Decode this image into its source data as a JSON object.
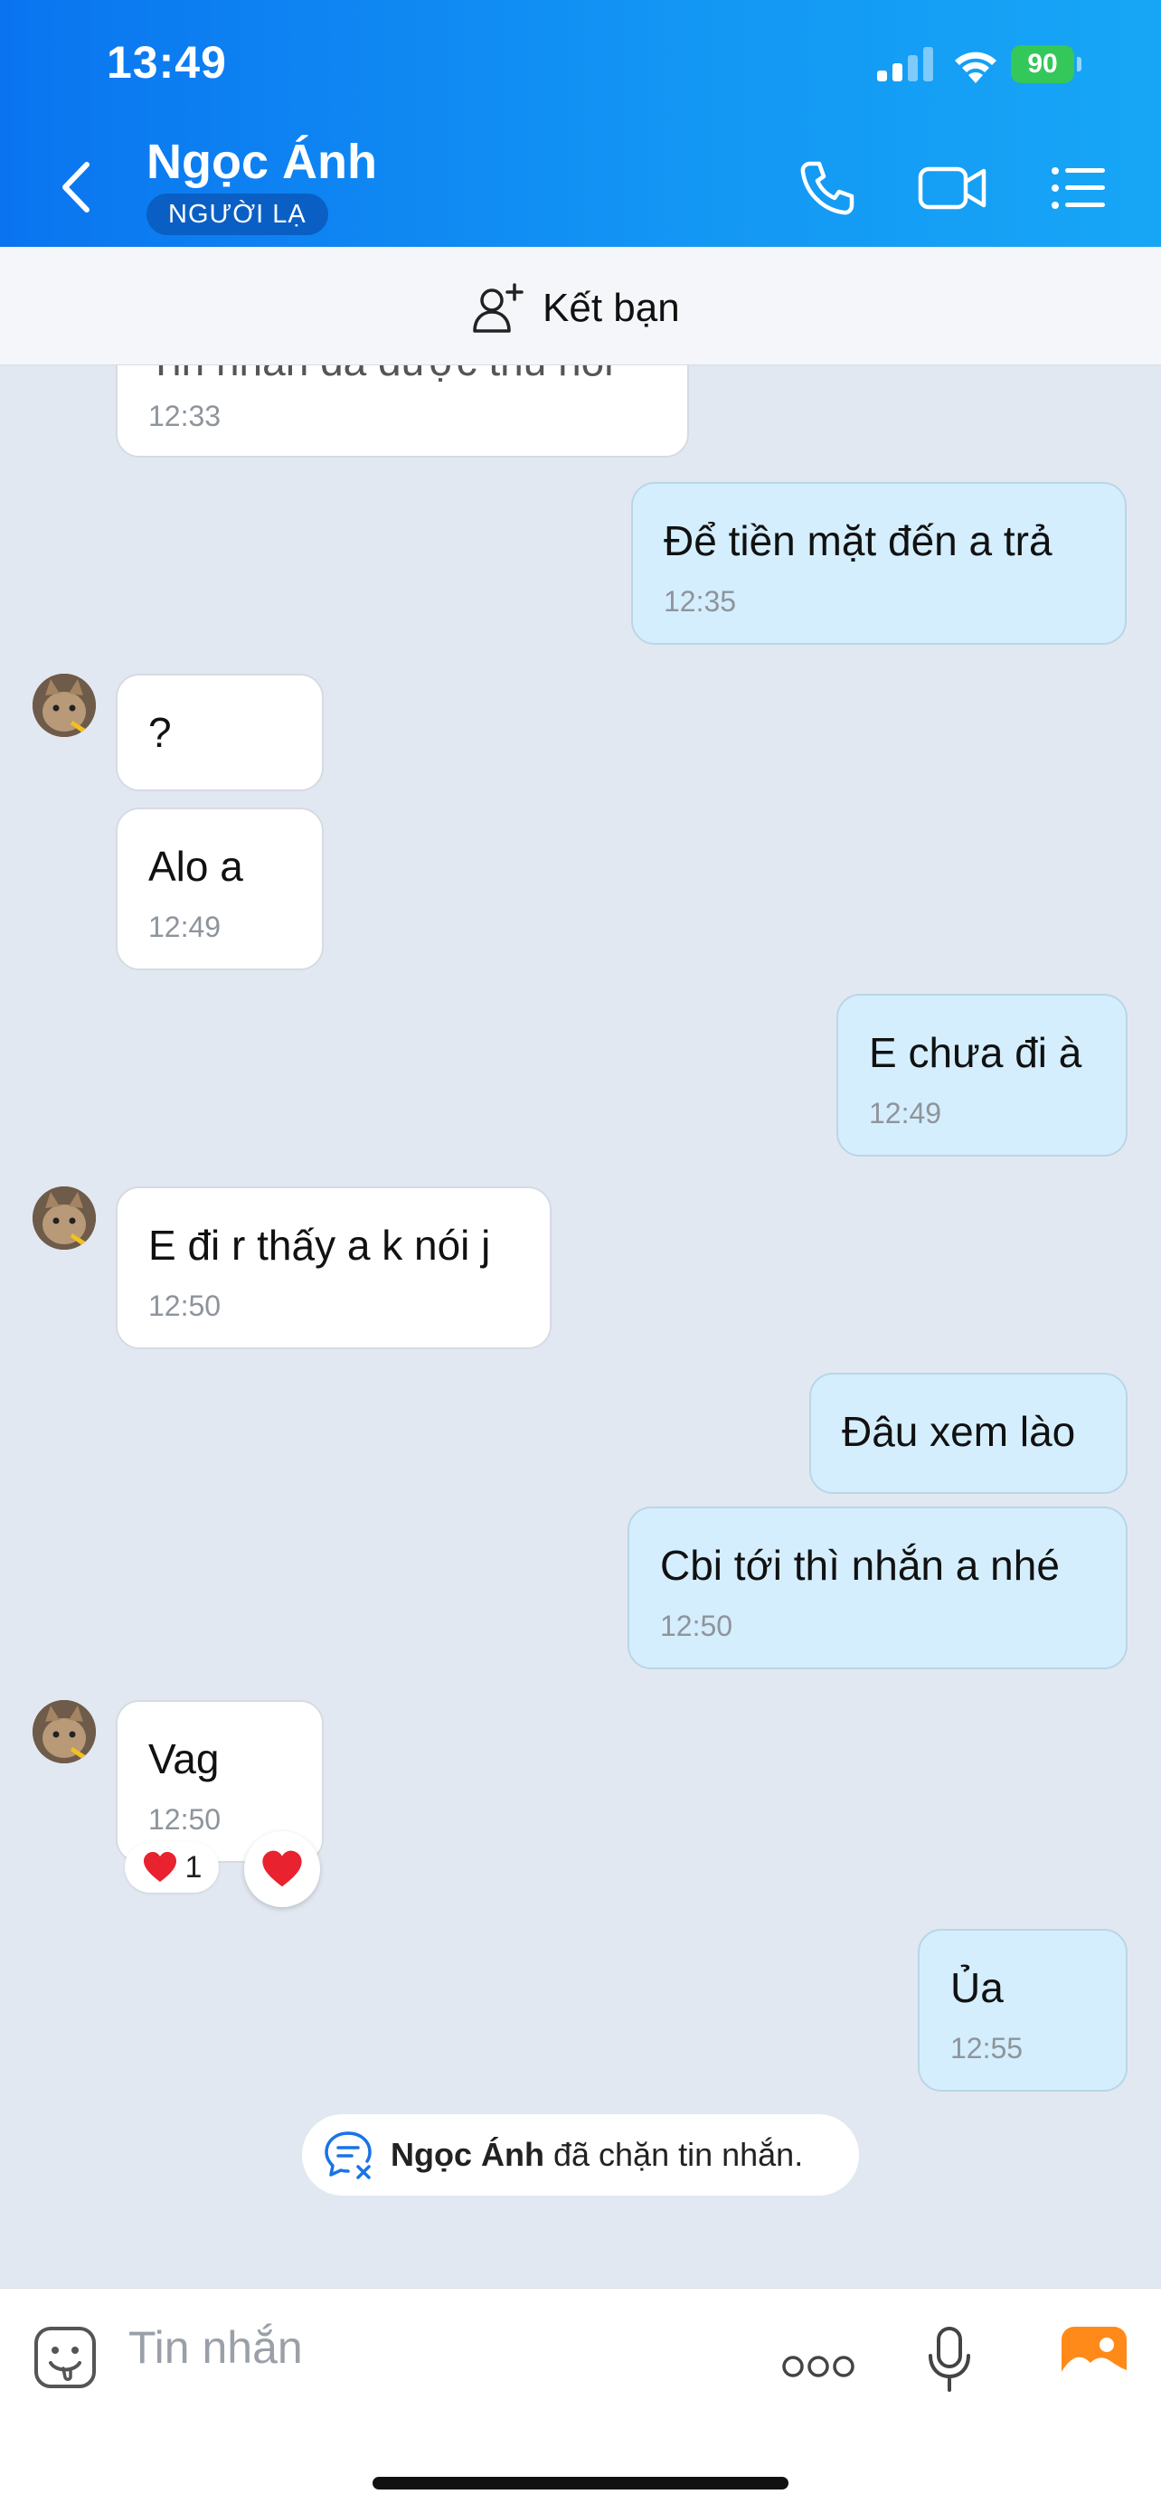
{
  "status_bar": {
    "time": "13:49",
    "battery": "90"
  },
  "header": {
    "contact_name": "Ngọc Ánh",
    "badge": "NGƯỜI LẠ"
  },
  "friend_bar": {
    "label": "Kết bạn"
  },
  "messages": [
    {
      "side": "in",
      "text": "Tin nhắn đã được thu hồi",
      "time": "12:33"
    },
    {
      "side": "out",
      "text": "Để tiền mặt đến a trả",
      "time": "12:35"
    },
    {
      "side": "in",
      "text": "?",
      "time": ""
    },
    {
      "side": "in",
      "text": "Alo a",
      "time": "12:49"
    },
    {
      "side": "out",
      "text": "E chưa đi à",
      "time": "12:49"
    },
    {
      "side": "in",
      "text": "E đi r thấy a k nói j",
      "time": "12:50"
    },
    {
      "side": "out",
      "text": "Đâu xem lào",
      "time": ""
    },
    {
      "side": "out",
      "text": "Cbi tới thì nhắn a nhé",
      "time": "12:50"
    },
    {
      "side": "in",
      "text": "Vag",
      "time": "12:50"
    },
    {
      "side": "out",
      "text": "Ủa",
      "time": "12:55"
    }
  ],
  "reaction": {
    "emoji": "heart",
    "count": "1"
  },
  "block_notice": {
    "name": "Ngọc Ánh",
    "text": " đã chặn tin nhắn."
  },
  "input": {
    "placeholder": "Tin nhắn"
  },
  "colors": {
    "header_blue": "#0a74f0",
    "bubble_out": "#d4eefd",
    "chat_bg": "#e2e8f1"
  }
}
